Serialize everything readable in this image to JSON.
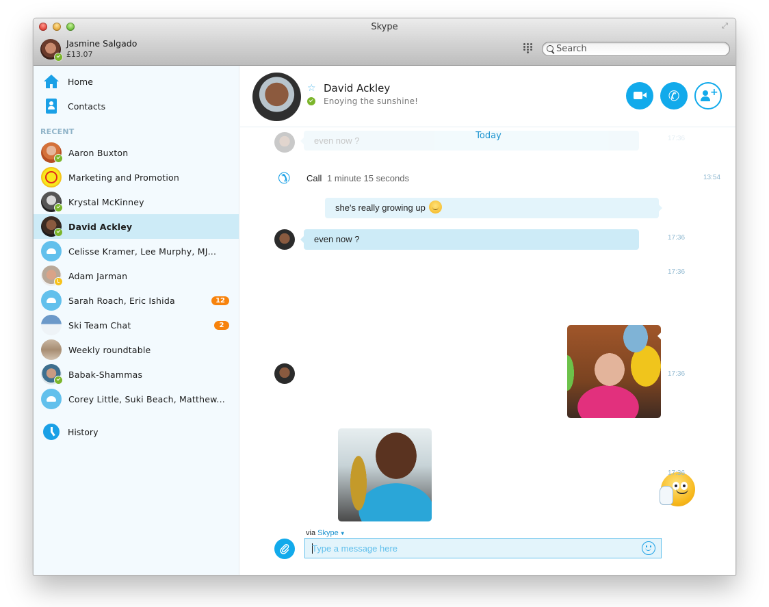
{
  "window": {
    "title": "Skype"
  },
  "account": {
    "name": "Jasmine Salgado",
    "credit": "£13.07",
    "status": "online"
  },
  "search": {
    "placeholder": "Search"
  },
  "sidebar": {
    "nav": [
      {
        "label": "Home",
        "icon": "home-icon"
      },
      {
        "label": "Contacts",
        "icon": "contacts-icon"
      }
    ],
    "recent_header": "RECENT",
    "recent": [
      {
        "name": "Aaron Buxton",
        "status": "online",
        "unread": null
      },
      {
        "name": "Marketing and Promotion",
        "status": null,
        "unread": null
      },
      {
        "name": "Krystal McKinney",
        "status": "online",
        "unread": null
      },
      {
        "name": "David Ackley",
        "status": "online",
        "unread": null,
        "selected": true
      },
      {
        "name": "Celisse Kramer, Lee Murphy, MJ...",
        "status": null,
        "unread": null
      },
      {
        "name": "Adam Jarman",
        "status": "away",
        "unread": null
      },
      {
        "name": "Sarah Roach, Eric Ishida",
        "status": null,
        "unread": "12"
      },
      {
        "name": "Ski Team Chat",
        "status": null,
        "unread": "2"
      },
      {
        "name": "Weekly roundtable",
        "status": null,
        "unread": null
      },
      {
        "name": "Babak-Shammas",
        "status": "online",
        "unread": null
      },
      {
        "name": "Corey Little, Suki Beach, Matthew...",
        "status": null,
        "unread": null
      }
    ],
    "history_label": "History"
  },
  "conversation": {
    "contact_name": "David Ackley",
    "mood": "Enoying the sunshine!",
    "status": "online",
    "actions": {
      "video_call": "video-call",
      "audio_call": "audio-call",
      "add_people": "add-people"
    },
    "date_divider": "Today",
    "messages": [
      {
        "type": "text",
        "direction": "in",
        "text": "even now ?",
        "time": "17:36",
        "faded": true
      },
      {
        "type": "call",
        "label": "Call",
        "duration": "1 minute 15 seconds",
        "time": "13:54"
      },
      {
        "type": "text",
        "direction": "out",
        "text": "she's really growing up",
        "emoticon": "smile"
      },
      {
        "type": "text",
        "direction": "in",
        "text": "even now ?",
        "time": "17:36"
      },
      {
        "type": "photo",
        "direction": "out",
        "subject": "girl with balloons",
        "time": "17:36"
      },
      {
        "type": "photo",
        "direction": "in",
        "subject": "boy with trophy",
        "time": "17:36"
      },
      {
        "type": "emoticon",
        "direction": "out",
        "emoticon": "wave",
        "time": "17:36"
      }
    ]
  },
  "composer": {
    "via_prefix": "via",
    "via_service": "Skype",
    "placeholder": "Type a message here",
    "value": ""
  },
  "colors": {
    "accent": "#12aaeb",
    "online": "#7cb52b",
    "away": "#f7c21b",
    "unread_badge": "#f7830d",
    "selected_row": "#cdebf7"
  }
}
